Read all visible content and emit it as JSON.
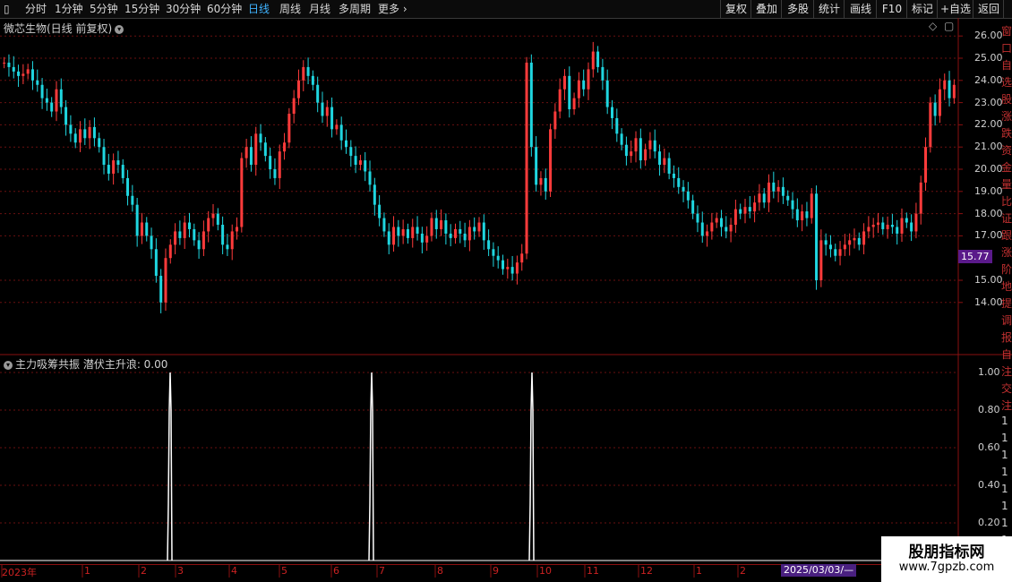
{
  "toolbar": {
    "periods": [
      "分时",
      "1分钟",
      "5分钟",
      "15分钟",
      "30分钟",
      "60分钟",
      "日线",
      "周线",
      "月线",
      "多周期",
      "更多"
    ],
    "active_period": "日线",
    "right_buttons": [
      "复权",
      "叠加",
      "多股",
      "统计",
      "画线",
      "F10",
      "标记",
      "+自选",
      "返回"
    ]
  },
  "main_panel": {
    "title": "微芯生物(日线 前复权)",
    "price_ticks": [
      "26.00",
      "25.00",
      "24.00",
      "23.00",
      "22.00",
      "21.00",
      "20.00",
      "19.00",
      "18.00",
      "17.00",
      "15.00",
      "14.00"
    ],
    "last_price": "15.77"
  },
  "indicator_panel": {
    "title": "主力吸筹共振 潜伏主升浪: 0.00",
    "ticks": [
      "1.00",
      "0.80",
      "0.60",
      "0.40",
      "0.20"
    ]
  },
  "timeline": {
    "labels": [
      "2023年",
      "1",
      "2",
      "3",
      "4",
      "5",
      "6",
      "7",
      "8",
      "9",
      "10",
      "11",
      "12",
      "1",
      "2"
    ],
    "cursor_date": "2025/03/03/—"
  },
  "side_strip_chars": [
    "窗",
    "口",
    "自",
    "选",
    "股",
    "涨",
    "跌",
    "资",
    "金",
    "量",
    "比",
    "证",
    "跟",
    "涨",
    "阶",
    "地",
    "提",
    "调",
    "报",
    "自",
    "注",
    "交",
    "注",
    "1",
    "1",
    "1",
    "1",
    "1",
    "1",
    "1",
    "1"
  ],
  "watermark": {
    "line1": "股朋指标网",
    "line2": "www.7gpzb.com"
  },
  "colors": {
    "up": "#ff3b3b",
    "down": "#1fd6e0",
    "accent": "#3fb3ff",
    "grid": "#6a1010",
    "tag": "#5a1a8a"
  },
  "chart_data": {
    "type": "candlestick",
    "title": "微芯生物(日线 前复权)",
    "ylim": [
      13.0,
      26.5
    ],
    "closes": [
      24.8,
      24.6,
      24.4,
      24.2,
      24.3,
      24.5,
      24.0,
      23.8,
      23.2,
      23.0,
      22.6,
      23.6,
      22.8,
      22.0,
      21.6,
      21.2,
      21.8,
      21.4,
      21.9,
      21.4,
      21.0,
      20.2,
      19.8,
      20.4,
      20.2,
      19.6,
      18.8,
      18.4,
      17.0,
      17.6,
      17.0,
      16.4,
      15.2,
      14.0,
      16.0,
      16.6,
      17.2,
      16.9,
      17.6,
      17.3,
      16.8,
      16.4,
      17.2,
      17.8,
      18.0,
      17.5,
      16.6,
      16.4,
      17.2,
      17.4,
      20.5,
      21.0,
      20.2,
      21.6,
      21.2,
      20.6,
      20.0,
      19.6,
      20.8,
      21.2,
      22.5,
      23.2,
      24.0,
      24.6,
      24.2,
      23.8,
      23.0,
      22.4,
      22.8,
      21.8,
      22.0,
      21.3,
      21.0,
      20.6,
      20.2,
      20.4,
      19.9,
      19.3,
      18.4,
      17.8,
      17.2,
      16.6,
      17.4,
      17.0,
      17.3,
      16.9,
      17.4,
      17.1,
      16.7,
      17.0,
      17.8,
      17.3,
      17.7,
      17.1,
      16.9,
      17.3,
      17.1,
      16.8,
      17.4,
      17.2,
      17.6,
      16.8,
      16.4,
      16.1,
      15.9,
      15.5,
      15.6,
      15.3,
      15.8,
      16.2,
      24.8,
      21.0,
      19.3,
      19.6,
      19.0,
      21.8,
      22.6,
      23.6,
      24.2,
      22.7,
      23.2,
      24.0,
      23.6,
      24.5,
      25.3,
      24.6,
      24.0,
      22.8,
      22.3,
      21.6,
      21.1,
      20.6,
      20.8,
      21.4,
      20.4,
      20.9,
      21.3,
      20.8,
      20.2,
      20.5,
      19.8,
      19.6,
      19.2,
      19.0,
      18.6,
      18.0,
      17.6,
      17.0,
      17.2,
      17.6,
      17.8,
      17.4,
      17.2,
      17.5,
      18.2,
      18.0,
      18.3,
      18.1,
      18.5,
      18.9,
      18.5,
      19.4,
      19.0,
      19.2,
      18.8,
      18.6,
      18.2,
      17.7,
      18.1,
      17.8,
      18.9,
      15.0,
      16.8,
      16.6,
      16.4,
      16.1,
      16.4,
      16.6,
      16.8,
      16.9,
      16.6,
      17.2,
      17.4,
      17.5,
      17.6,
      17.3,
      17.5,
      17.4,
      17.1,
      17.8,
      17.6,
      17.2,
      18.0,
      19.4,
      21.0,
      23.0,
      22.4,
      23.6,
      24.0,
      23.2,
      23.8
    ],
    "indicator_signals": [
      0.0,
      0.0,
      0.0,
      1.0,
      0.0,
      0.0,
      0.0,
      1.0,
      0.0,
      0.0,
      1.0,
      0.0,
      0.0,
      0.0,
      0.0
    ]
  }
}
